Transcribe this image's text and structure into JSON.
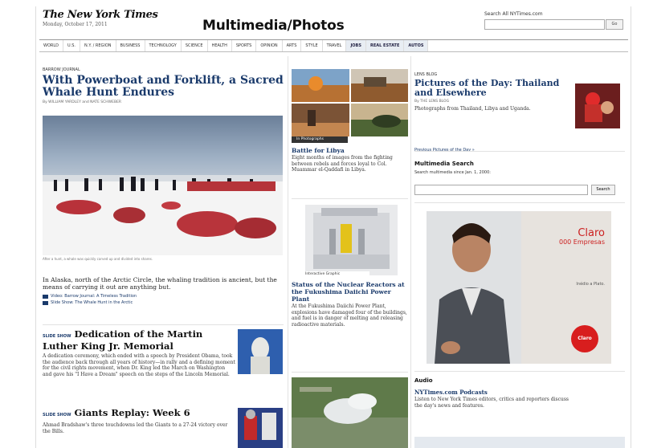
{
  "header": {
    "logo": "The New York Times",
    "date": "Monday, October 17, 2011",
    "section_title": "Multimedia/Photos",
    "search_label": "Search All NYTimes.com",
    "search_placeholder": "",
    "search_go": "Go"
  },
  "nav": {
    "items": [
      "WORLD",
      "U.S.",
      "N.Y. / REGION",
      "BUSINESS",
      "TECHNOLOGY",
      "SCIENCE",
      "HEALTH",
      "SPORTS",
      "OPINION",
      "ARTS",
      "STYLE",
      "TRAVEL"
    ],
    "alt_items": [
      "JOBS",
      "REAL ESTATE",
      "AUTOS"
    ]
  },
  "col1": {
    "kicker": "BARROW JOURNAL",
    "headline": "With Powerboat and Forklift, a Sacred Whale Hunt Endures",
    "byline": "By WILLIAM YARDLEY and NATE SCHWEBER",
    "photo_caption": "After a hunt, a whale was quickly carved up and divided into shares.",
    "summary": "In Alaska, north of the Arctic Circle, the whaling tradition is ancient, but the means of carrying it out are anything but.",
    "link1": "Video: Barrow Journal: A Timeless Tradition",
    "link2": "Slide Show: The Whale Hunt in the Arctic",
    "story2_prefix": "SLIDE SHOW",
    "story2_title": "Dedication of the Martin Luther King Jr. Memorial",
    "story2_text": "A dedication ceremony, which ended with a speech by President Obama, took the audience back through all years of history—in rally and a defining moment for the civil rights movement, when Dr. King led the March on Washington and gave his \"I Have a Dream\" speech on the steps of the Lincoln Memorial.",
    "story3_prefix": "SLIDE SHOW",
    "story3_title": "Giants Replay: Week 6",
    "story3_text": "Ahmad Bradshaw's three touchdowns led the Giants to a 27-24 victory over the Bills."
  },
  "col2": {
    "strip_label": "In Photographs",
    "story1_title": "Battle for Libya",
    "story1_text": "Eight months of images from the fighting between rebels and forces loyal to Col. Muammar el-Qaddafi in Libya.",
    "graphic_label": "Interactive Graphic",
    "story2_title": "Status of the Nuclear Reactors at the Fukushima Daiichi Power Plant",
    "story2_text": "At the Fukushima Daiichi Power Plant, explosions have damaged four of the buildings, and fuel is in danger of melting and releasing radioactive materials."
  },
  "col3": {
    "kicker": "LENS BLOG",
    "headline": "Pictures of the Day: Thailand and Elsewhere",
    "byline": "By THE LENS BLOG",
    "summary": "Photographs from Thailand, Libya and Uganda.",
    "prev_link": "Previous Pictures of the Day »",
    "mm_search_title": "Multimedia Search",
    "mm_search_label": "Search multimedia since Jan. 1, 2000:",
    "mm_search_button": "Search",
    "audio_title": "Audio",
    "audio_link": "NYTimes.com Podcasts",
    "audio_text": "Listen to New York Times editors, critics and reporters discuss the day's news and features."
  },
  "ad": {
    "brand": "Claro",
    "line1": "000 Empresas",
    "line2": "Inédio a Plato.",
    "badge": "Claro"
  }
}
